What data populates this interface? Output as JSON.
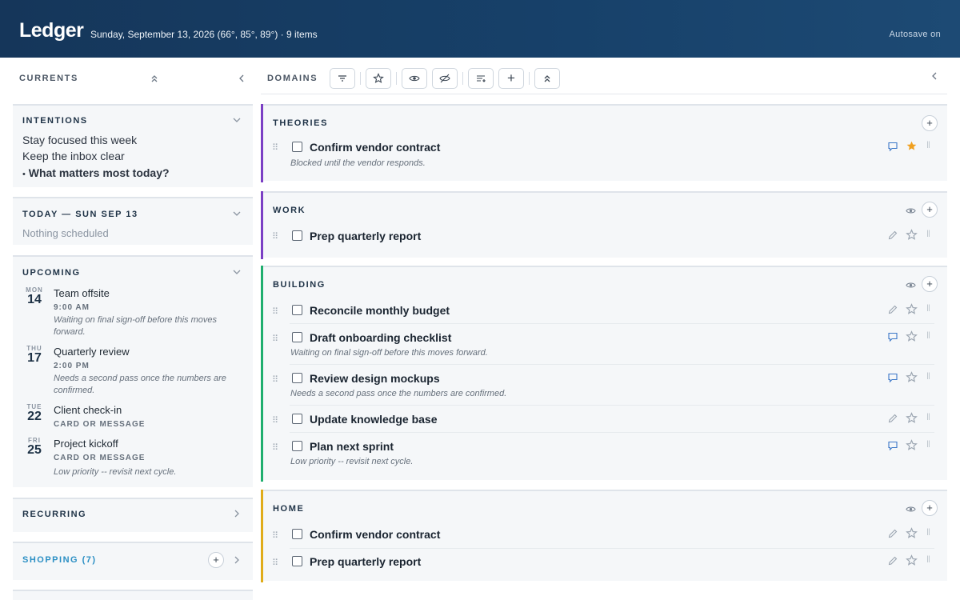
{
  "header": {
    "logo": "Ledger",
    "subtitle": "Sunday, September 13, 2026 (66°, 85°, 89°) · 9 items",
    "autosave": "Autosave on"
  },
  "left": {
    "title": "CURRENTS",
    "intentions": {
      "title": "INTENTIONS",
      "items": [
        "Stay focused this week",
        "Keep the inbox clear"
      ],
      "prompt": "What matters most today?"
    },
    "today": {
      "title": "TODAY — SUN SEP 13",
      "empty": "Nothing scheduled"
    },
    "upcoming": {
      "title": "UPCOMING",
      "events": [
        {
          "dow": "MON",
          "day": "14",
          "title": "Team offsite",
          "sub": "9:00 AM",
          "note": "Waiting on final sign-off before this moves forward."
        },
        {
          "dow": "THU",
          "day": "17",
          "title": "Quarterly review",
          "sub": "2:00 PM",
          "note": "Needs a second pass once the numbers are confirmed."
        },
        {
          "dow": "TUE",
          "day": "22",
          "title": "Client check-in",
          "sub": "CARD OR MESSAGE",
          "note": ""
        },
        {
          "dow": "FRI",
          "day": "25",
          "title": "Project kickoff",
          "sub": "CARD OR MESSAGE",
          "note": "Low priority -- revisit next cycle."
        }
      ]
    },
    "recurring": {
      "title": "RECURRING"
    },
    "shopping": {
      "title": "SHOPPING (7)"
    }
  },
  "right": {
    "title": "DOMAINS",
    "domains": [
      {
        "title": "THEORIES",
        "color": "#7b3fc4",
        "tasks": [
          {
            "title": "Confirm vendor contract",
            "note": "Blocked until the vendor responds."
          }
        ]
      },
      {
        "title": "WORK",
        "color": "#7b3fc4",
        "tasks": [
          {
            "title": "Prep quarterly report",
            "note": ""
          }
        ]
      },
      {
        "title": "BUILDING",
        "color": "#1fae6e",
        "tasks": [
          {
            "title": "Reconcile monthly budget",
            "note": ""
          },
          {
            "title": "Draft onboarding checklist",
            "note": "Waiting on final sign-off before this moves forward."
          },
          {
            "title": "Review design mockups",
            "note": "Needs a second pass once the numbers are confirmed."
          },
          {
            "title": "Update knowledge base",
            "note": ""
          },
          {
            "title": "Plan next sprint",
            "note": "Low priority -- revisit next cycle."
          }
        ]
      },
      {
        "title": "HOME",
        "color": "#e0ac1a",
        "tasks": [
          {
            "title": "Confirm vendor contract",
            "note": ""
          },
          {
            "title": "Prep quarterly report",
            "note": ""
          }
        ]
      }
    ]
  },
  "icons": {
    "filter": "filter-icon",
    "star": "star-icon",
    "eye": "eye-icon",
    "eye-off": "eye-off-icon",
    "sort": "sort-icon",
    "plus": "plus-icon",
    "collapse": "collapse-all-icon",
    "chevron-left": "chevron-left-icon"
  }
}
